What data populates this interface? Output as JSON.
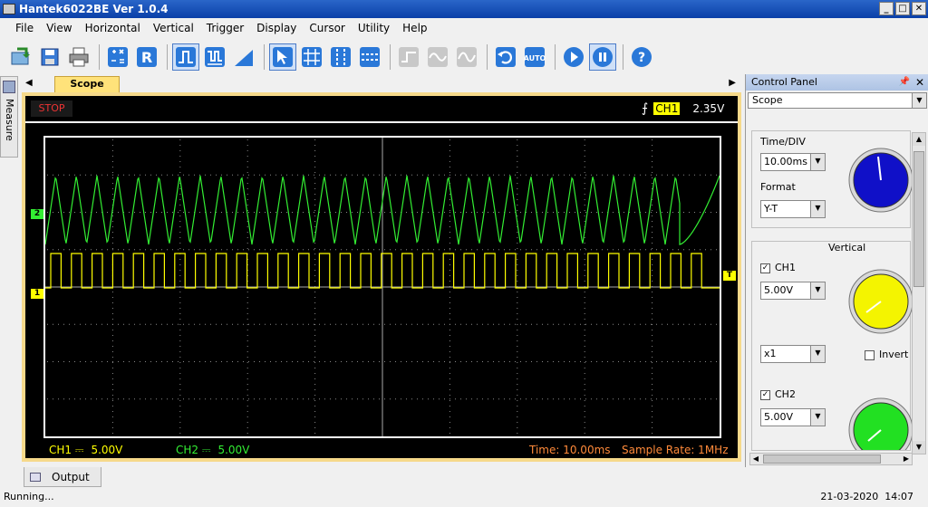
{
  "window": {
    "title": "Hantek6022BE Ver 1.0.4",
    "buttons": [
      "_",
      "□",
      "✕"
    ]
  },
  "menu": [
    "File",
    "View",
    "Horizontal",
    "Vertical",
    "Trigger",
    "Display",
    "Cursor",
    "Utility",
    "Help"
  ],
  "toolbar": {
    "icons": [
      "open-icon",
      "save-icon",
      "print-icon",
      "auto-measure-icon",
      "reset-icon",
      "rising-edge-icon",
      "pulse-icon",
      "ramp-icon",
      "pointer-icon",
      "grid-icon",
      "vertical-cursor-icon",
      "horizontal-cursor-icon",
      "step-icon",
      "sine-icon",
      "wave-icon",
      "undo-icon",
      "auto-icon",
      "run-icon",
      "pause-icon",
      "help-icon"
    ],
    "auto_label": "AUTO"
  },
  "sidetab": {
    "label": "Measure"
  },
  "tabs": {
    "scope": "Scope"
  },
  "scope": {
    "status": "STOP",
    "trigger_channel": "CH1",
    "trigger_level": "2.35V",
    "ch1_label": "CH1",
    "ch1_scale": "5.00V",
    "ch2_label": "CH2",
    "ch2_scale": "5.00V",
    "time": "Time: 10.00ms",
    "sample_rate": "Sample Rate: 1MHz",
    "marker_ch1": "1",
    "marker_ch2": "2",
    "marker_trigger": "T",
    "ch1_color": "#ffff00",
    "ch2_color": "#33ee33"
  },
  "output_tab": "Output",
  "status": {
    "left": "Running...",
    "date": "21-03-2020",
    "time": "14:07"
  },
  "control_panel": {
    "title": "Control Panel",
    "mode": "Scope",
    "time_div_label": "Time/DIV",
    "time_div_value": "10.00ms",
    "format_label": "Format",
    "format_value": "Y-T",
    "vertical_label": "Vertical",
    "ch1_label": "CH1",
    "ch1_volts": "5.00V",
    "probe": "x1",
    "invert_label": "Invert",
    "ch2_label": "CH2",
    "ch2_volts": "5.00V",
    "ch1_checked": true,
    "ch2_checked": true,
    "invert_checked": false
  }
}
